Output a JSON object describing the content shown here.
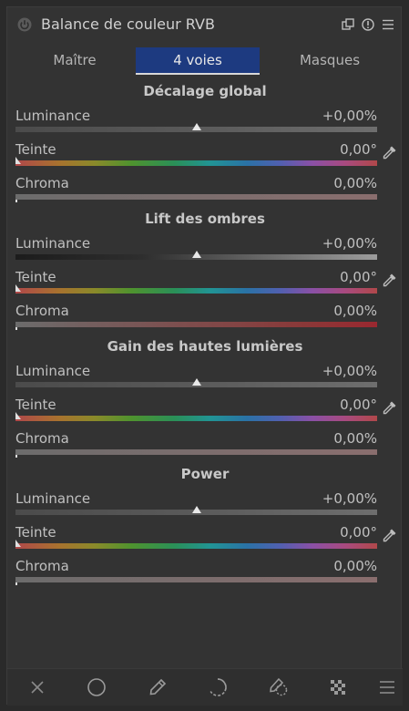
{
  "header": {
    "title": "Balance de couleur RVB",
    "icons": [
      "power-icon",
      "multi-instance-icon",
      "reset-icon",
      "presets-menu-icon"
    ]
  },
  "tabs": [
    {
      "label": "Maître",
      "active": false
    },
    {
      "label": "4 voies",
      "active": true
    },
    {
      "label": "Masques",
      "active": false
    }
  ],
  "sections": [
    {
      "title": "Décalage global",
      "sliders": [
        {
          "label": "Luminance",
          "value": "+0,00%"
        },
        {
          "label": "Teinte",
          "value": "0,00°"
        },
        {
          "label": "Chroma",
          "value": "0,00%"
        }
      ]
    },
    {
      "title": "Lift des ombres",
      "sliders": [
        {
          "label": "Luminance",
          "value": "+0,00%"
        },
        {
          "label": "Teinte",
          "value": "0,00°"
        },
        {
          "label": "Chroma",
          "value": "0,00%"
        }
      ]
    },
    {
      "title": "Gain des hautes lumières",
      "sliders": [
        {
          "label": "Luminance",
          "value": "+0,00%"
        },
        {
          "label": "Teinte",
          "value": "0,00°"
        },
        {
          "label": "Chroma",
          "value": "0,00%"
        }
      ]
    },
    {
      "title": "Power",
      "sliders": [
        {
          "label": "Luminance",
          "value": "+0,00%"
        },
        {
          "label": "Teinte",
          "value": "0,00°"
        },
        {
          "label": "Chroma",
          "value": "0,00%"
        }
      ]
    }
  ],
  "bottom_bar": {
    "icons": [
      "off-icon",
      "drawn-mask-icon",
      "parametric-mask-icon",
      "drawn-parametric-mask-icon",
      "raster-mask-icon",
      "blend-options-icon",
      "more-options-icon"
    ]
  },
  "colors": {
    "panel_bg": "#333333",
    "active_tab": "#1d3a80",
    "text": "#c8c8c8"
  }
}
